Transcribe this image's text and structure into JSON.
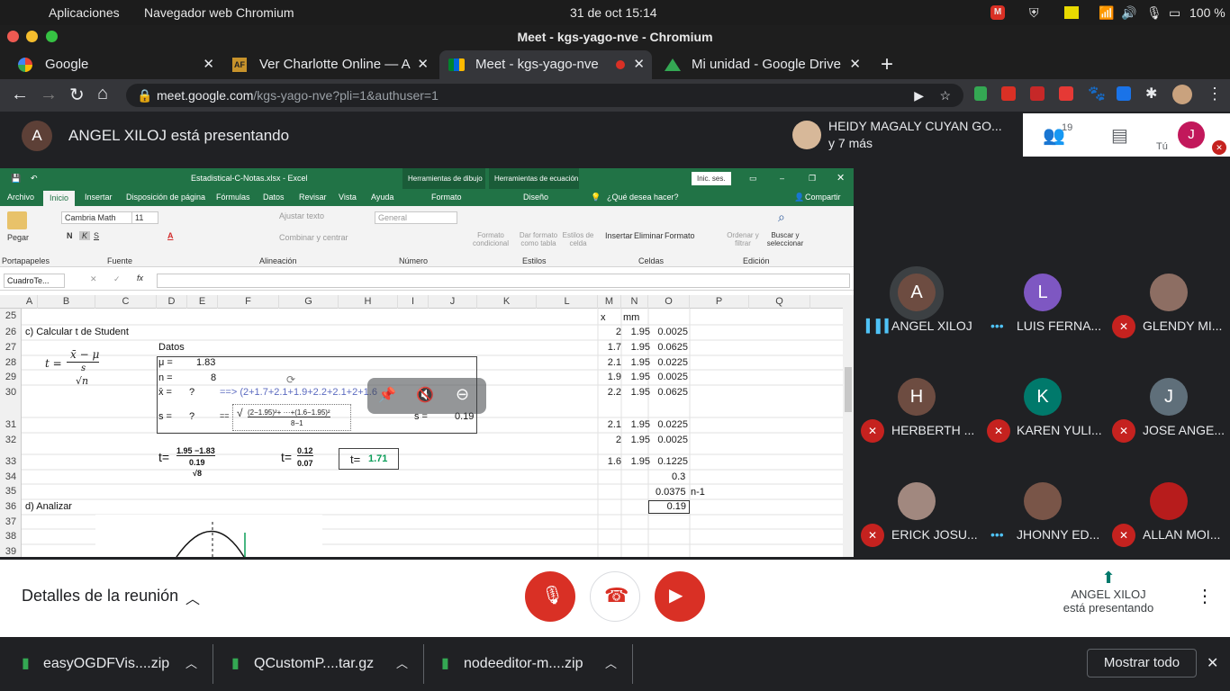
{
  "os": {
    "apps": "Aplicaciones",
    "browser": "Navegador web Chromium",
    "datetime": "31 de oct  15:14",
    "battery": "100 %"
  },
  "window": {
    "title": "Meet - kgs-yago-nve - Chromium"
  },
  "tabs": [
    {
      "label": "Google",
      "icon": "google-icon"
    },
    {
      "label": "Ver Charlotte Online — A",
      "icon": "af-icon"
    },
    {
      "label": "Meet - kgs-yago-nve",
      "icon": "meet-icon"
    },
    {
      "label": "Mi unidad - Google Drive",
      "icon": "drive-icon"
    }
  ],
  "address": {
    "host": "meet.google.com",
    "path": "/kgs-yago-nve?pli=1&authuser=1"
  },
  "meet": {
    "presenter_initial": "A",
    "presenting_text": "ANGEL XILOJ está presentando",
    "host_name": "HEIDY MAGALY CUYAN GO...",
    "host_more": "y 7 más",
    "people_count": "19",
    "you_label": "Tú",
    "you_initial": "J",
    "participants": [
      {
        "initial": "A",
        "name": "ANGEL XILOJ",
        "color": "#6d4c41",
        "status": "speaking"
      },
      {
        "initial": "L",
        "name": "LUIS FERNA...",
        "color": "#7e57c2",
        "status": "active"
      },
      {
        "initial": "",
        "name": "GLENDY MI...",
        "color": "#8d6e63",
        "status": "muted"
      },
      {
        "initial": "H",
        "name": "HERBERTH ...",
        "color": "#6d4c41",
        "status": "muted"
      },
      {
        "initial": "K",
        "name": "KAREN YULI...",
        "color": "#00796b",
        "status": "muted"
      },
      {
        "initial": "J",
        "name": "JOSE ANGE...",
        "color": "#5f6f7a",
        "status": "muted"
      },
      {
        "initial": "",
        "name": "ERICK JOSU...",
        "color": "#a1887f",
        "status": "muted"
      },
      {
        "initial": "",
        "name": "JHONNY ED...",
        "color": "#795548",
        "status": "active"
      },
      {
        "initial": "",
        "name": "ALLAN MOI...",
        "color": "#b71c1c",
        "status": "muted"
      }
    ],
    "details_label": "Detalles de la reunión",
    "presenting_bottom_name": "ANGEL XILOJ",
    "presenting_bottom_sub": "está presentando"
  },
  "excel": {
    "filename": "Estadistical-C-Notas.xlsx - Excel",
    "tools1": "Herramientas de dibujo",
    "tools2": "Herramientas de ecuación",
    "signin": "Inic. ses.",
    "menu": [
      "Archivo",
      "Inicio",
      "Insertar",
      "Disposición de página",
      "Fórmulas",
      "Datos",
      "Revisar",
      "Vista",
      "Ayuda",
      "Formato",
      "Diseño"
    ],
    "tell_me": "¿Qué desea hacer?",
    "share": "Compartir",
    "ribbon": {
      "paste": "Pegar",
      "font": "Cambria Math",
      "size": "11",
      "wrap": "Ajustar texto",
      "merge": "Combinar y centrar",
      "numfmt": "General",
      "cond": "Formato condicional",
      "table": "Dar formato como tabla",
      "styles": "Estilos de celda",
      "insert": "Insertar",
      "delete": "Eliminar",
      "format": "Formato",
      "sort": "Ordenar y filtrar",
      "find": "Buscar y seleccionar",
      "groups": [
        "Portapapeles",
        "Fuente",
        "Alineación",
        "Número",
        "Estilos",
        "Celdas",
        "Edición"
      ]
    },
    "namebox": "CuadroTe...",
    "cols": [
      "A",
      "B",
      "C",
      "D",
      "E",
      "F",
      "G",
      "H",
      "I",
      "J",
      "K",
      "L",
      "M",
      "N",
      "O",
      "P",
      "Q"
    ],
    "rows": [
      "25",
      "26",
      "27",
      "28",
      "29",
      "30",
      "31",
      "32",
      "33",
      "34",
      "35",
      "36",
      "37",
      "38",
      "39"
    ],
    "cells": {
      "c26": "c)  Calcular t de Student",
      "datos": "Datos",
      "mu_l": "μ =",
      "mu_v": "1.83",
      "n_l": "n =",
      "n_v": "8",
      "xbar_l": "x̄ =",
      "xbar_v": "?",
      "s_l": "s =",
      "s_v": "?",
      "xbar_formula": "==> (2+1.7+2.1+1.9+2.2+2.1+2+1.6",
      "s_eq": "==",
      "s_formula": "(2−1.95)²+ ···+(1.6−1.95)²",
      "s_denom": "8−1",
      "s_res_l": "s =",
      "s_res_v": "0.19",
      "t1": "t=",
      "t1_num": "1.95 −1.83",
      "t1_den": "0.19",
      "t1_sqrt": "√8",
      "t2": "t=",
      "t2_num": "0.12",
      "t2_den": "0.07",
      "t3": "t=",
      "t3_v": "1.71",
      "d36": "d)  Analizar",
      "formula_main": "t =",
      "formula_num": "x̄ − μ",
      "formula_s": "s",
      "formula_sqrt": "√n",
      "x_h": "x",
      "mm_h": "mm"
    },
    "table": [
      [
        "2",
        "1.95",
        "0.0025"
      ],
      [
        "1.7",
        "1.95",
        "0.0625"
      ],
      [
        "2.1",
        "1.95",
        "0.0225"
      ],
      [
        "1.9",
        "1.95",
        "0.0025"
      ],
      [
        "2.2",
        "1.95",
        "0.0625"
      ],
      [
        "2.1",
        "1.95",
        "0.0225"
      ],
      [
        "2",
        "1.95",
        "0.0025"
      ],
      [
        "1.6",
        "1.95",
        "0.1225"
      ]
    ],
    "sum": "0.3",
    "var": "0.0375",
    "var_note": "n-1",
    "sd": "0.19"
  },
  "downloads": [
    {
      "name": "easyOGDFVis....zip"
    },
    {
      "name": "QCustomP....tar.gz"
    },
    {
      "name": "nodeeditor-m....zip"
    }
  ],
  "show_all": "Mostrar todo"
}
